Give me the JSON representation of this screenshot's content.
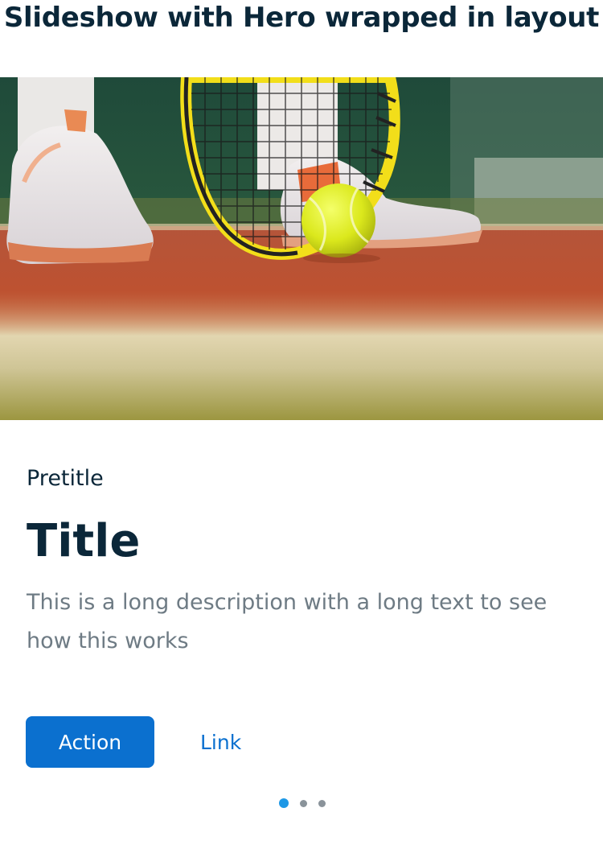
{
  "page": {
    "title": "Slideshow with Hero wrapped in layout"
  },
  "hero": {
    "image_subject": "tennis-court-scene",
    "pretitle": "Pretitle",
    "title": "Title",
    "description": "This is a long description with a long text to see how this works",
    "primary_action_label": "Action",
    "link_label": "Link"
  },
  "pagination": {
    "total": 3,
    "active_index": 0
  },
  "colors": {
    "primary": "#0b70cf",
    "text_dark": "#0b2739",
    "text_muted": "#6e7b84",
    "dot_active": "#1e98e6",
    "dot_inactive": "#8a939a"
  }
}
